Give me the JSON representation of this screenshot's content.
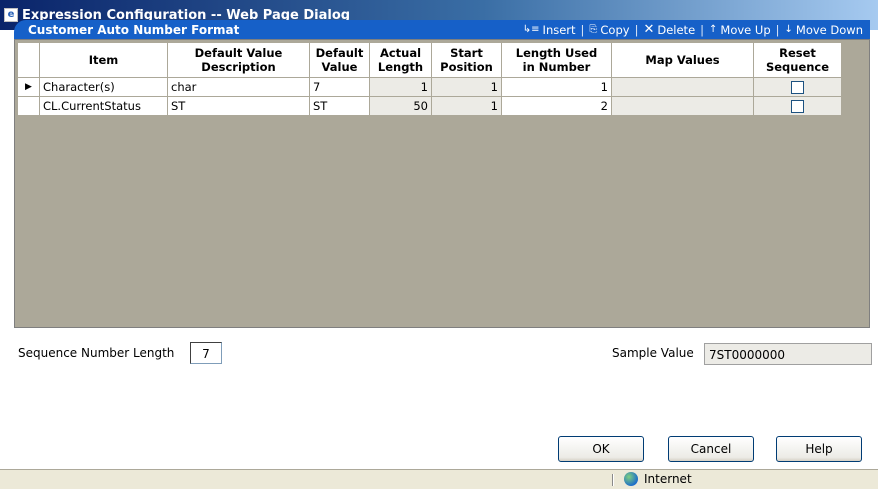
{
  "window": {
    "title": "Expression Configuration -- Web Page Dialog"
  },
  "panel": {
    "title": "Customer Auto Number Format"
  },
  "toolbar": {
    "insert": "Insert",
    "copy": "Copy",
    "delete": "Delete",
    "move_up": "Move Up",
    "move_down": "Move Down"
  },
  "grid": {
    "headers": {
      "item": "Item",
      "default_value_description_1": "Default Value",
      "default_value_description_2": "Description",
      "default_value_1": "Default",
      "default_value_2": "Value",
      "actual_length_1": "Actual",
      "actual_length_2": "Length",
      "start_position_1": "Start",
      "start_position_2": "Position",
      "length_used_1": "Length Used",
      "length_used_2": "in Number",
      "map_values": "Map Values",
      "reset_sequence_1": "Reset",
      "reset_sequence_2": "Sequence"
    },
    "rows": [
      {
        "selected_marker": "▶",
        "item": "Character(s)",
        "description": "char",
        "default_value": "7",
        "actual_length": "1",
        "start_position": "1",
        "length_used": "1",
        "map_values": "",
        "reset_sequence": false
      },
      {
        "selected_marker": "",
        "item": "CL.CurrentStatus",
        "description": "ST",
        "default_value": "ST",
        "actual_length": "50",
        "start_position": "1",
        "length_used": "2",
        "map_values": "",
        "reset_sequence": false
      }
    ]
  },
  "sequence": {
    "label": "Sequence Number Length",
    "value": "7"
  },
  "sample": {
    "label": "Sample Value",
    "value": "7ST0000000"
  },
  "buttons": {
    "ok": "OK",
    "cancel": "Cancel",
    "help": "Help"
  },
  "statusbar": {
    "zone": "Internet"
  }
}
